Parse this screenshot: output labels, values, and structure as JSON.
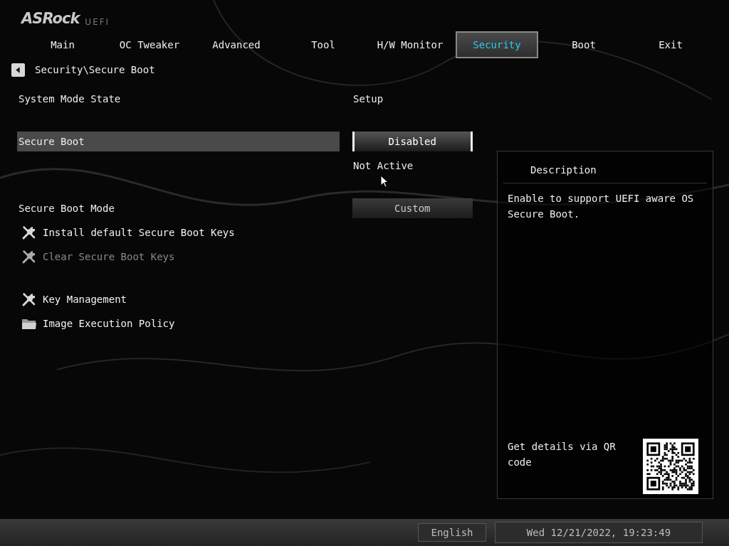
{
  "logo": {
    "brand": "ASRock",
    "suffix": "UEFI"
  },
  "tabs": [
    {
      "label": "Main",
      "selected": false
    },
    {
      "label": "OC Tweaker",
      "selected": false
    },
    {
      "label": "Advanced",
      "selected": false
    },
    {
      "label": "Tool",
      "selected": false
    },
    {
      "label": "H/W Monitor",
      "selected": false
    },
    {
      "label": "Security",
      "selected": true
    },
    {
      "label": "Boot",
      "selected": false
    },
    {
      "label": "Exit",
      "selected": false
    }
  ],
  "breadcrumb": "Security\\Secure Boot",
  "settings": [
    {
      "kind": "info",
      "label": "System Mode State",
      "value": "Setup"
    },
    {
      "kind": "spacer"
    },
    {
      "kind": "option",
      "label": "Secure Boot",
      "value": "Disabled",
      "selected": true
    },
    {
      "kind": "note",
      "value": "Not Active"
    },
    {
      "kind": "spacer"
    },
    {
      "kind": "option",
      "label": "Secure Boot Mode",
      "value": "Custom",
      "selected": false
    },
    {
      "kind": "tool",
      "label": "Install default Secure Boot Keys",
      "disabled": false
    },
    {
      "kind": "tool",
      "label": "Clear Secure Boot Keys",
      "disabled": true
    },
    {
      "kind": "spacer"
    },
    {
      "kind": "tool",
      "label": "Key Management",
      "disabled": false
    },
    {
      "kind": "folder",
      "label": "Image Execution Policy",
      "disabled": false
    }
  ],
  "description": {
    "title": "Description",
    "text": "Enable to support UEFI aware OS Secure Boot.",
    "qr_hint": "Get details via QR code"
  },
  "status_bar": {
    "language": "English",
    "datetime": "Wed 12/21/2022, 19:23:49"
  }
}
